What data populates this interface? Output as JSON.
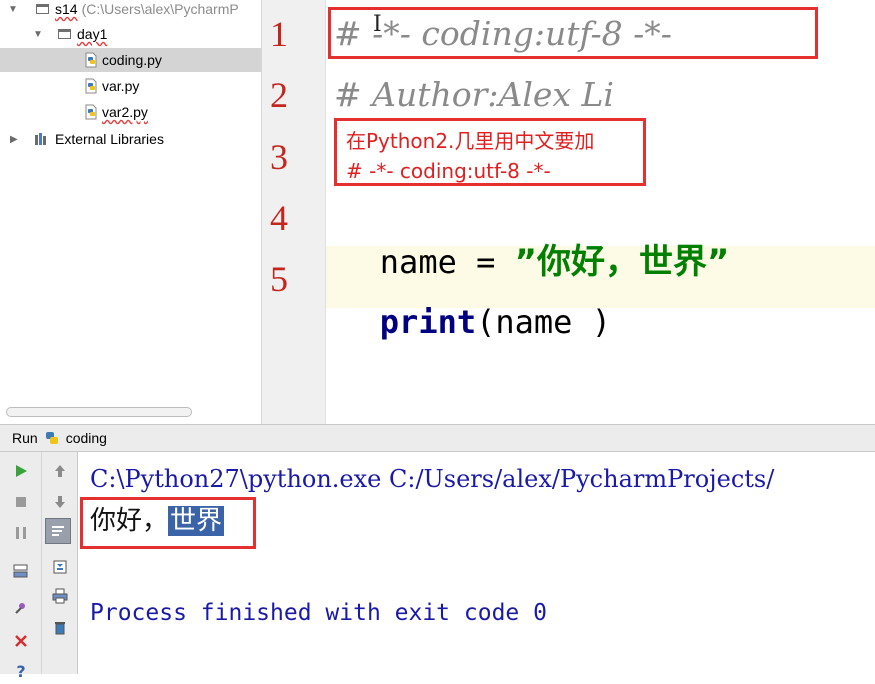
{
  "project_tree": {
    "root": {
      "name": "s14",
      "path": "(C:\\Users\\alex\\PycharmP"
    },
    "folder": "day1",
    "files": [
      "coding.py",
      "var.py",
      "var2.py"
    ],
    "selected_file": "coding.py",
    "external_libraries": "External Libraries"
  },
  "editor": {
    "line_numbers": [
      "1",
      "2",
      "3",
      "4",
      "5"
    ],
    "line1": "# -*- coding:utf-8 -*-",
    "line2": "# Author:Alex Li",
    "line4": {
      "var": "name",
      "op": " = ",
      "string": "”你好，世界”"
    },
    "line5": {
      "keyword": "print",
      "args": "(name )"
    },
    "annotation": {
      "line_a": "在Python2.几里用中文要加",
      "line_b": "# -*- coding:utf-8 -*-"
    }
  },
  "run_panel": {
    "title": "Run",
    "config": "coding",
    "console": {
      "command": "C:\\Python27\\python.exe C:/Users/alex/PycharmProjects/",
      "output_prefix": "你好，",
      "output_selected": "世界",
      "exit": "Process finished with exit code 0"
    }
  },
  "colors": {
    "line_number": "#c4261e",
    "comment": "#8a8a8a",
    "string": "#008000",
    "keyword": "#000080",
    "annotation_red": "#e53030",
    "console_blue": "#1a1aa8",
    "selection": "#3b64a8"
  }
}
